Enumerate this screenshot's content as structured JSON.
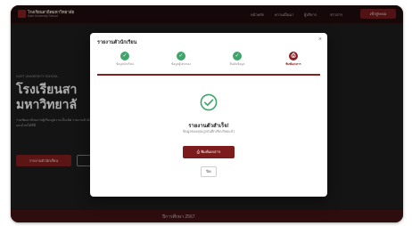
{
  "header": {
    "logo_title": "โรงเรียนสาธิตมหาวิทยาลัย",
    "logo_subtitle": "Satit University School",
    "nav_items": [
      "หน้าหลัก",
      "ความเป็นมา",
      "ผู้บริหาร",
      "ข่าวสาร"
    ],
    "login_button": "เข้าสู่ระบบ"
  },
  "hero": {
    "kicker": "SATIT UNIVERSITY SCHOOL",
    "title": "โรงเรียนสา\nมหาวิทยาลั",
    "description": "ร่วมพัฒนาศักยภาพผู้เรียนสู่ความเป็นเลิศ รายงานตัวนักเรียนออนไลน์ได้ที่นี่",
    "primary_button": "รายงานตัวนักเรียน"
  },
  "bottom_bar": {
    "text": "ปีการศึกษา 2567"
  },
  "modal": {
    "title": "รายงานตัวนักเรียน",
    "close_symbol": "×",
    "steps": [
      {
        "label": "ข้อมูลนักเรียน",
        "state": "done"
      },
      {
        "label": "ข้อมูลผู้ปกครอง",
        "state": "done"
      },
      {
        "label": "ยืนยันข้อมูล",
        "state": "done"
      },
      {
        "label": "พิมพ์เอกสาร",
        "state": "active"
      }
    ],
    "success_title": "รายงานตัวสำเร็จ!",
    "success_subtitle": "ข้อมูลของคุณถูกบันทึกเรียบร้อยแล้ว",
    "print_button": "พิมพ์เอกสาร",
    "close_button": "ปิด",
    "colors": {
      "accent": "#8a1f1f",
      "success": "#3fa56a"
    }
  }
}
